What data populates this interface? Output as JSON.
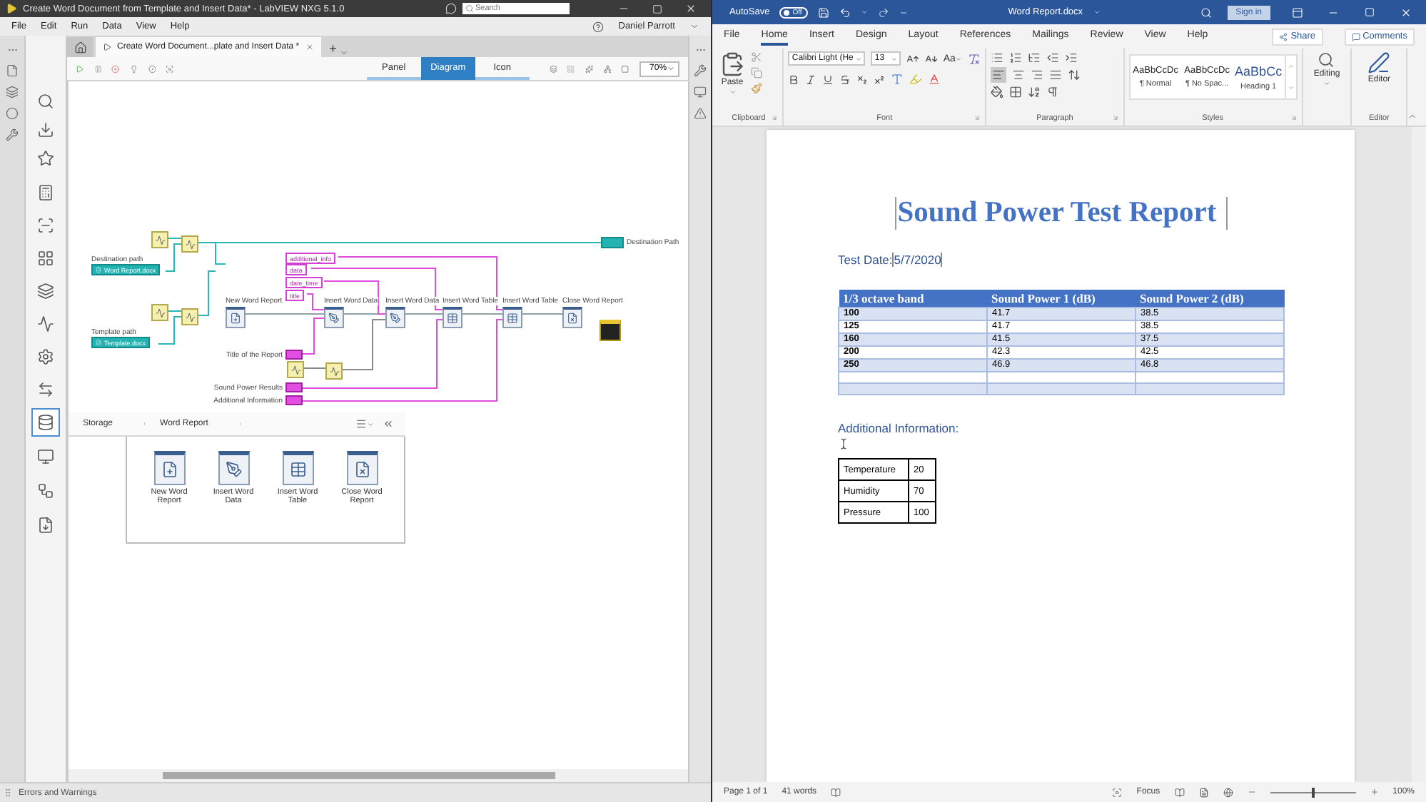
{
  "labview": {
    "title": "Create Word Document from Template and Insert Data* - LabVIEW NXG 5.1.0",
    "search": {
      "placeholder": "Search"
    },
    "menu": [
      "File",
      "Edit",
      "Run",
      "Data",
      "View",
      "Help"
    ],
    "user": "Daniel Parrott",
    "categories": [
      {
        "selected": false
      },
      {
        "selected": false
      },
      {
        "selected": false
      },
      {
        "selected": false
      },
      {
        "selected": false
      },
      {
        "selected": false
      },
      {
        "selected": false
      },
      {
        "selected": false
      },
      {
        "selected": false
      },
      {
        "selected": false
      },
      {
        "selected": true
      },
      {
        "selected": false
      },
      {
        "selected": false
      },
      {
        "selected": false
      }
    ],
    "doc_tab": "Create Word Document...plate and Insert Data *",
    "new_tab": "+",
    "view_tabs": [
      {
        "label": "Panel",
        "selected": false
      },
      {
        "label": "Diagram",
        "selected": true
      },
      {
        "label": "Icon",
        "selected": false
      }
    ],
    "zoom": "70%",
    "diagram": {
      "indicator": "Destination Path",
      "controls": [
        {
          "label": "Destination path",
          "value": "Word Report.docx"
        },
        {
          "label": "Template path",
          "value": "Template.docx"
        }
      ],
      "constants": [
        "additional_info",
        "data",
        "date_time",
        "title"
      ],
      "nodes": [
        {
          "label": "New Word Report",
          "kind": "new"
        },
        {
          "label": "Insert Word Data",
          "kind": "data"
        },
        {
          "label": "Insert Word Data",
          "kind": "data"
        },
        {
          "label": "Insert Word Table",
          "kind": "table"
        },
        {
          "label": "Insert Word Table",
          "kind": "table"
        },
        {
          "label": "Close Word Report",
          "kind": "close"
        }
      ],
      "inputs": [
        "Title of the Report",
        "Sound Power Results",
        "Additional Information"
      ]
    },
    "palette": {
      "breadcrumb": [
        "Storage",
        "Word Report"
      ],
      "items": [
        {
          "label": "New Word Report",
          "kind": "new"
        },
        {
          "label": "Insert Word Data",
          "kind": "data"
        },
        {
          "label": "Insert Word Table",
          "kind": "table"
        },
        {
          "label": "Close Word Report",
          "kind": "close"
        }
      ]
    },
    "status": "Errors and Warnings"
  },
  "word": {
    "autosave": {
      "label": "AutoSave",
      "on": false,
      "text": "Off"
    },
    "filename": "Word Report.docx",
    "sign_in": "Sign in",
    "tabs": [
      {
        "label": "File",
        "selected": false
      },
      {
        "label": "Home",
        "selected": true
      },
      {
        "label": "Insert",
        "selected": false
      },
      {
        "label": "Design",
        "selected": false
      },
      {
        "label": "Layout",
        "selected": false
      },
      {
        "label": "References",
        "selected": false
      },
      {
        "label": "Mailings",
        "selected": false
      },
      {
        "label": "Review",
        "selected": false
      },
      {
        "label": "View",
        "selected": false
      },
      {
        "label": "Help",
        "selected": false
      }
    ],
    "share": "Share",
    "comments": "Comments",
    "ribbon": {
      "paste": "Paste",
      "font": "Calibri Light (He",
      "size": "13",
      "change_case": "Aa",
      "styles": [
        {
          "preview": "AaBbCcDc",
          "name": "¶ Normal",
          "kind": "body"
        },
        {
          "preview": "AaBbCcDc",
          "name": "¶ No Spac...",
          "kind": "body"
        },
        {
          "preview": "AaBbCc",
          "name": "Heading 1",
          "kind": "heading"
        }
      ],
      "editing": "Editing",
      "editor": "Editor",
      "groups": [
        "Clipboard",
        "Font",
        "Paragraph",
        "Styles",
        "Editor"
      ]
    },
    "document": {
      "title": "Sound Power Test Report",
      "date_label": "Test Date:",
      "date": "5/7/2020",
      "table": {
        "columns": [
          "1/3 octave band",
          "Sound Power 1 (dB)",
          "Sound Power 2 (dB)"
        ],
        "rows": [
          [
            "100",
            "41.7",
            "38.5"
          ],
          [
            "125",
            "41.7",
            "38.5"
          ],
          [
            "160",
            "41.5",
            "37.5"
          ],
          [
            "200",
            "42.3",
            "42.5"
          ],
          [
            "250",
            "46.9",
            "46.8"
          ]
        ]
      },
      "info_heading": "Additional Information:",
      "info": [
        [
          "Temperature",
          "20"
        ],
        [
          "Humidity",
          "70"
        ],
        [
          "Pressure",
          "100"
        ]
      ]
    },
    "status": {
      "page": "Page 1 of 1",
      "words": "41 words",
      "focus": "Focus",
      "zoom_slider": {
        "level": 0.5
      },
      "zoom": "100%"
    }
  }
}
